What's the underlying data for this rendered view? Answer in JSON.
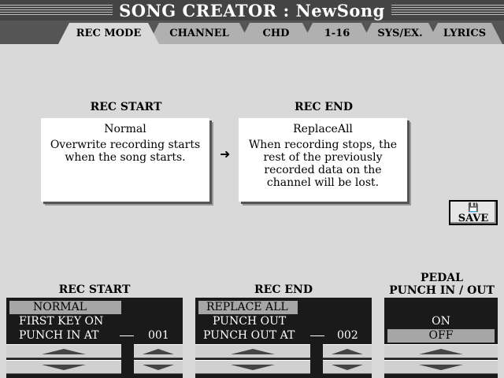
{
  "title": "SONG CREATOR : NewSong",
  "tabs": [
    {
      "label": "REC MODE",
      "active": true
    },
    {
      "label": "CHANNEL",
      "active": false
    },
    {
      "label": "CHD",
      "active": false
    },
    {
      "label": "1-16",
      "active": false
    },
    {
      "label": "SYS/EX.",
      "active": false
    },
    {
      "label": "LYRICS",
      "active": false
    }
  ],
  "rec_start_info": {
    "heading": "REC START",
    "name": "Normal",
    "description": "Overwrite recording starts when the song starts."
  },
  "rec_end_info": {
    "heading": "REC END",
    "name": "ReplaceAll",
    "description": "When recording stops, the rest of the previously recorded data on the channel will be lost."
  },
  "arrow_icon": "arrow-right-icon",
  "save": {
    "label": "SAVE",
    "icon": "floppy-disk-icon"
  },
  "rec_start_panel": {
    "heading": "REC START",
    "options": [
      "NORMAL",
      "FIRST KEY ON",
      "PUNCH IN AT"
    ],
    "selected": "NORMAL",
    "punch_value": "001"
  },
  "rec_end_panel": {
    "heading": "REC END",
    "options": [
      "REPLACE ALL",
      "PUNCH OUT",
      "PUNCH OUT AT"
    ],
    "selected": "REPLACE ALL",
    "punch_value": "002"
  },
  "pedal_panel": {
    "heading_line1": "PEDAL",
    "heading_line2": "PUNCH IN / OUT",
    "options": [
      "ON",
      "OFF"
    ],
    "selected": "OFF"
  },
  "colors": {
    "background": "#d9d9d9",
    "titlebar": "#444444",
    "panel": "#1a1a1a",
    "selected_row": "#a6a6a6"
  }
}
